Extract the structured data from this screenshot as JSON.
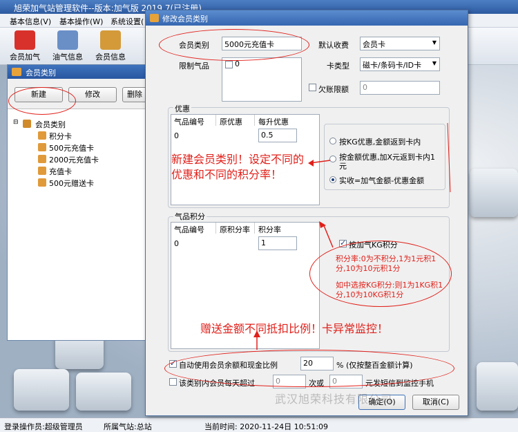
{
  "main": {
    "title": "旭荣加气站管理软件--版本:加气版 2019.7(已注册)",
    "menu": [
      "基本信息(V)",
      "基本操作(W)",
      "系统设置("
    ],
    "toolbar": [
      "会员加气",
      "油气信息",
      "会员信息"
    ]
  },
  "left_panel": {
    "title": "会员类别",
    "buttons": [
      "新建",
      "修改",
      "删除"
    ],
    "tree_root": "会员类别",
    "tree_items": [
      "积分卡",
      "500元充值卡",
      "2000元充值卡",
      "充值卡",
      "500元赠送卡"
    ]
  },
  "dialog": {
    "title": "修改会员类别",
    "member_type_label": "会员类别",
    "member_type_value": "5000元充值卡",
    "default_charge_label": "默认收费",
    "default_charge_value": "会员卡",
    "limit_gas_label": "限制气品",
    "limit_gas_value": "0",
    "card_type_label": "卡类型",
    "card_type_value": "磁卡/条码卡/ID卡",
    "overdraft_label": "欠账限额",
    "overdraft_value": "0",
    "discount": {
      "group": "优惠",
      "headers": [
        "气品编号",
        "原优惠",
        "每升优惠"
      ],
      "row": [
        "0",
        "",
        "0.5"
      ],
      "options": [
        "按KG优惠,金额返到卡内",
        "按金额优惠,加X元返到卡内1元",
        "实收=加气金额-优惠金额"
      ],
      "selected": 2
    },
    "points": {
      "group": "气品积分",
      "headers": [
        "气品编号",
        "原积分率",
        "积分率"
      ],
      "row": [
        "0",
        "",
        "1"
      ],
      "kg_points_label": "按加气KG积分"
    },
    "auto_use_label": "自动使用会员余额和现金比例",
    "auto_use_value": "20",
    "auto_use_suffix": "% (仅按整百金额计算)",
    "daily_limit_label": "该类别内会员每天超过",
    "daily_limit_times": "0",
    "daily_limit_mid": "次或",
    "daily_limit_amount": "0",
    "daily_limit_suffix": "元发短信到监控手机",
    "ok_button": "确定(O)",
    "cancel_button": "取消(C)"
  },
  "annotations": {
    "new_category": "新建会员类别！设定不同的优惠和不同的积分率！",
    "points_note1": "积分率:0为不积分,1为1元积1分,10为10元积1分",
    "points_note2": "如中选按KG积分:则1为1KG积1分,10为10KG积1分",
    "gift_note": "赠送金额不同抵扣比例！卡异常监控！"
  },
  "status": {
    "operator": "登录操作员:超级管理员",
    "station": "所属气站:总站",
    "time": "当前时间:  2020-11-24日 10:51:09"
  },
  "watermark": "武汉旭荣科技有限公司"
}
